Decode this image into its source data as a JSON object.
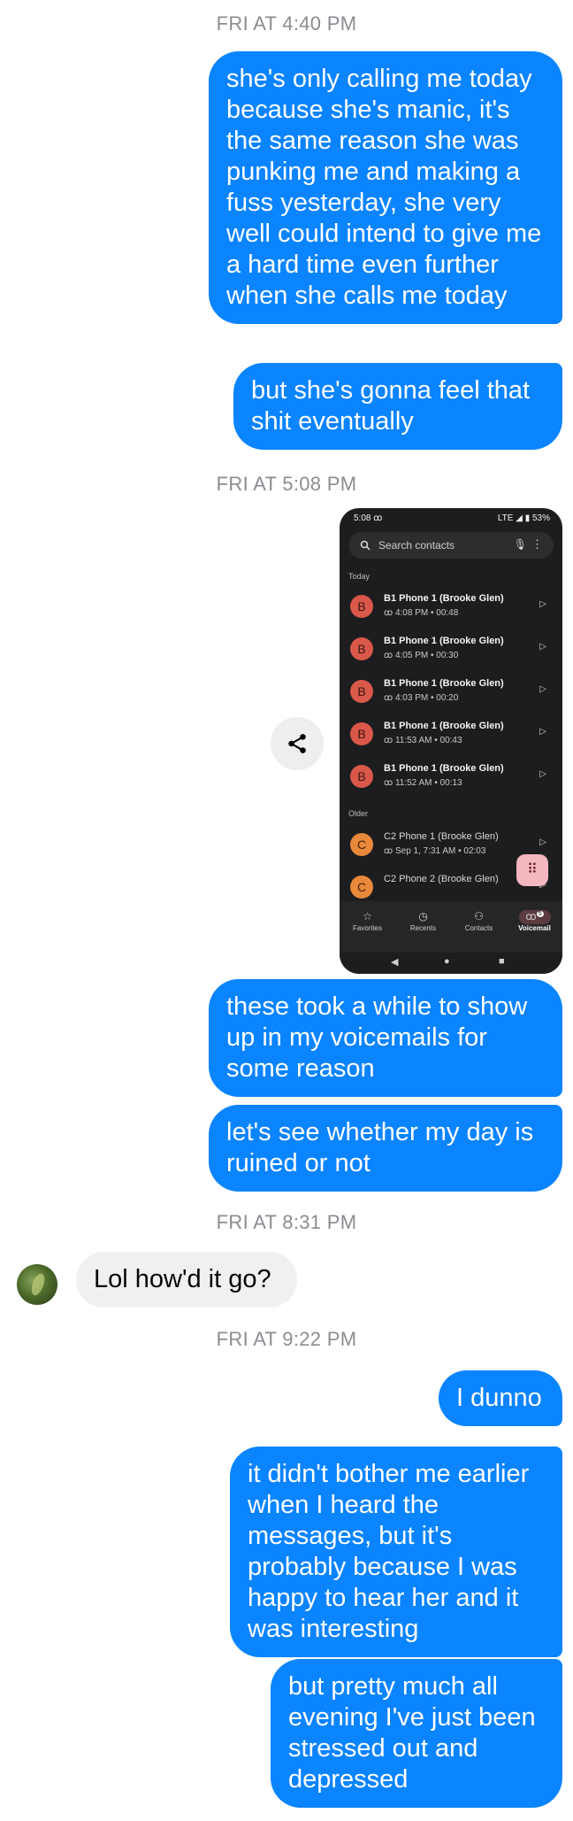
{
  "timestamps": [
    "FRI AT 4:40 PM",
    "FRI AT 5:08 PM",
    "FRI AT 8:31 PM",
    "FRI AT 9:22 PM"
  ],
  "messages": {
    "m1": "she's only calling me today because she's manic, it's the same reason she was punking me and making a fuss yesterday, she very well could intend to give me a hard time even further when she calls me today",
    "m2": "but she's gonna feel that shit eventually",
    "m3": "these took a while to show up in my voicemails for some reason",
    "m4": "let's see whether my day is ruined or not",
    "m5": "Lol how'd it go?",
    "m6": "I dunno",
    "m7": "it didn't bother me earlier when I heard the messages, but it's probably because I was happy to hear her and it was interesting",
    "m8": "but pretty much all evening I've just been stressed out and depressed"
  },
  "phone": {
    "status_time": "5:08 ꝏ",
    "status_right": "LTE ◢ ▮ 53%",
    "search_placeholder": "Search contacts",
    "section_today": "Today",
    "section_older": "Older",
    "voicemails": [
      {
        "initial": "B",
        "name": "B1 Phone 1 (Brooke Glen)",
        "meta": "ꝏ 4:08 PM • 00:48"
      },
      {
        "initial": "B",
        "name": "B1 Phone 1 (Brooke Glen)",
        "meta": "ꝏ 4:05 PM • 00:30"
      },
      {
        "initial": "B",
        "name": "B1 Phone 1 (Brooke Glen)",
        "meta": "ꝏ 4:03 PM • 00:20"
      },
      {
        "initial": "B",
        "name": "B1 Phone 1 (Brooke Glen)",
        "meta": "ꝏ 11:53 AM • 00:43"
      },
      {
        "initial": "B",
        "name": "B1 Phone 1 (Brooke Glen)",
        "meta": "ꝏ 11:52 AM • 00:13"
      }
    ],
    "older": [
      {
        "initial": "C",
        "name": "C2 Phone 1 (Brooke Glen)",
        "meta": "ꝏ Sep 1, 7:31 AM • 02:03"
      },
      {
        "initial": "C",
        "name": "C2 Phone 2 (Brooke Glen)",
        "meta": ""
      }
    ],
    "nav": [
      "Favorites",
      "Recents",
      "Contacts",
      "Voicemail"
    ],
    "voicemail_badge": "5"
  },
  "colors": {
    "outgoing": "#0a84ff",
    "incoming": "#f0f0f0",
    "timestamp": "#8a8d91"
  }
}
